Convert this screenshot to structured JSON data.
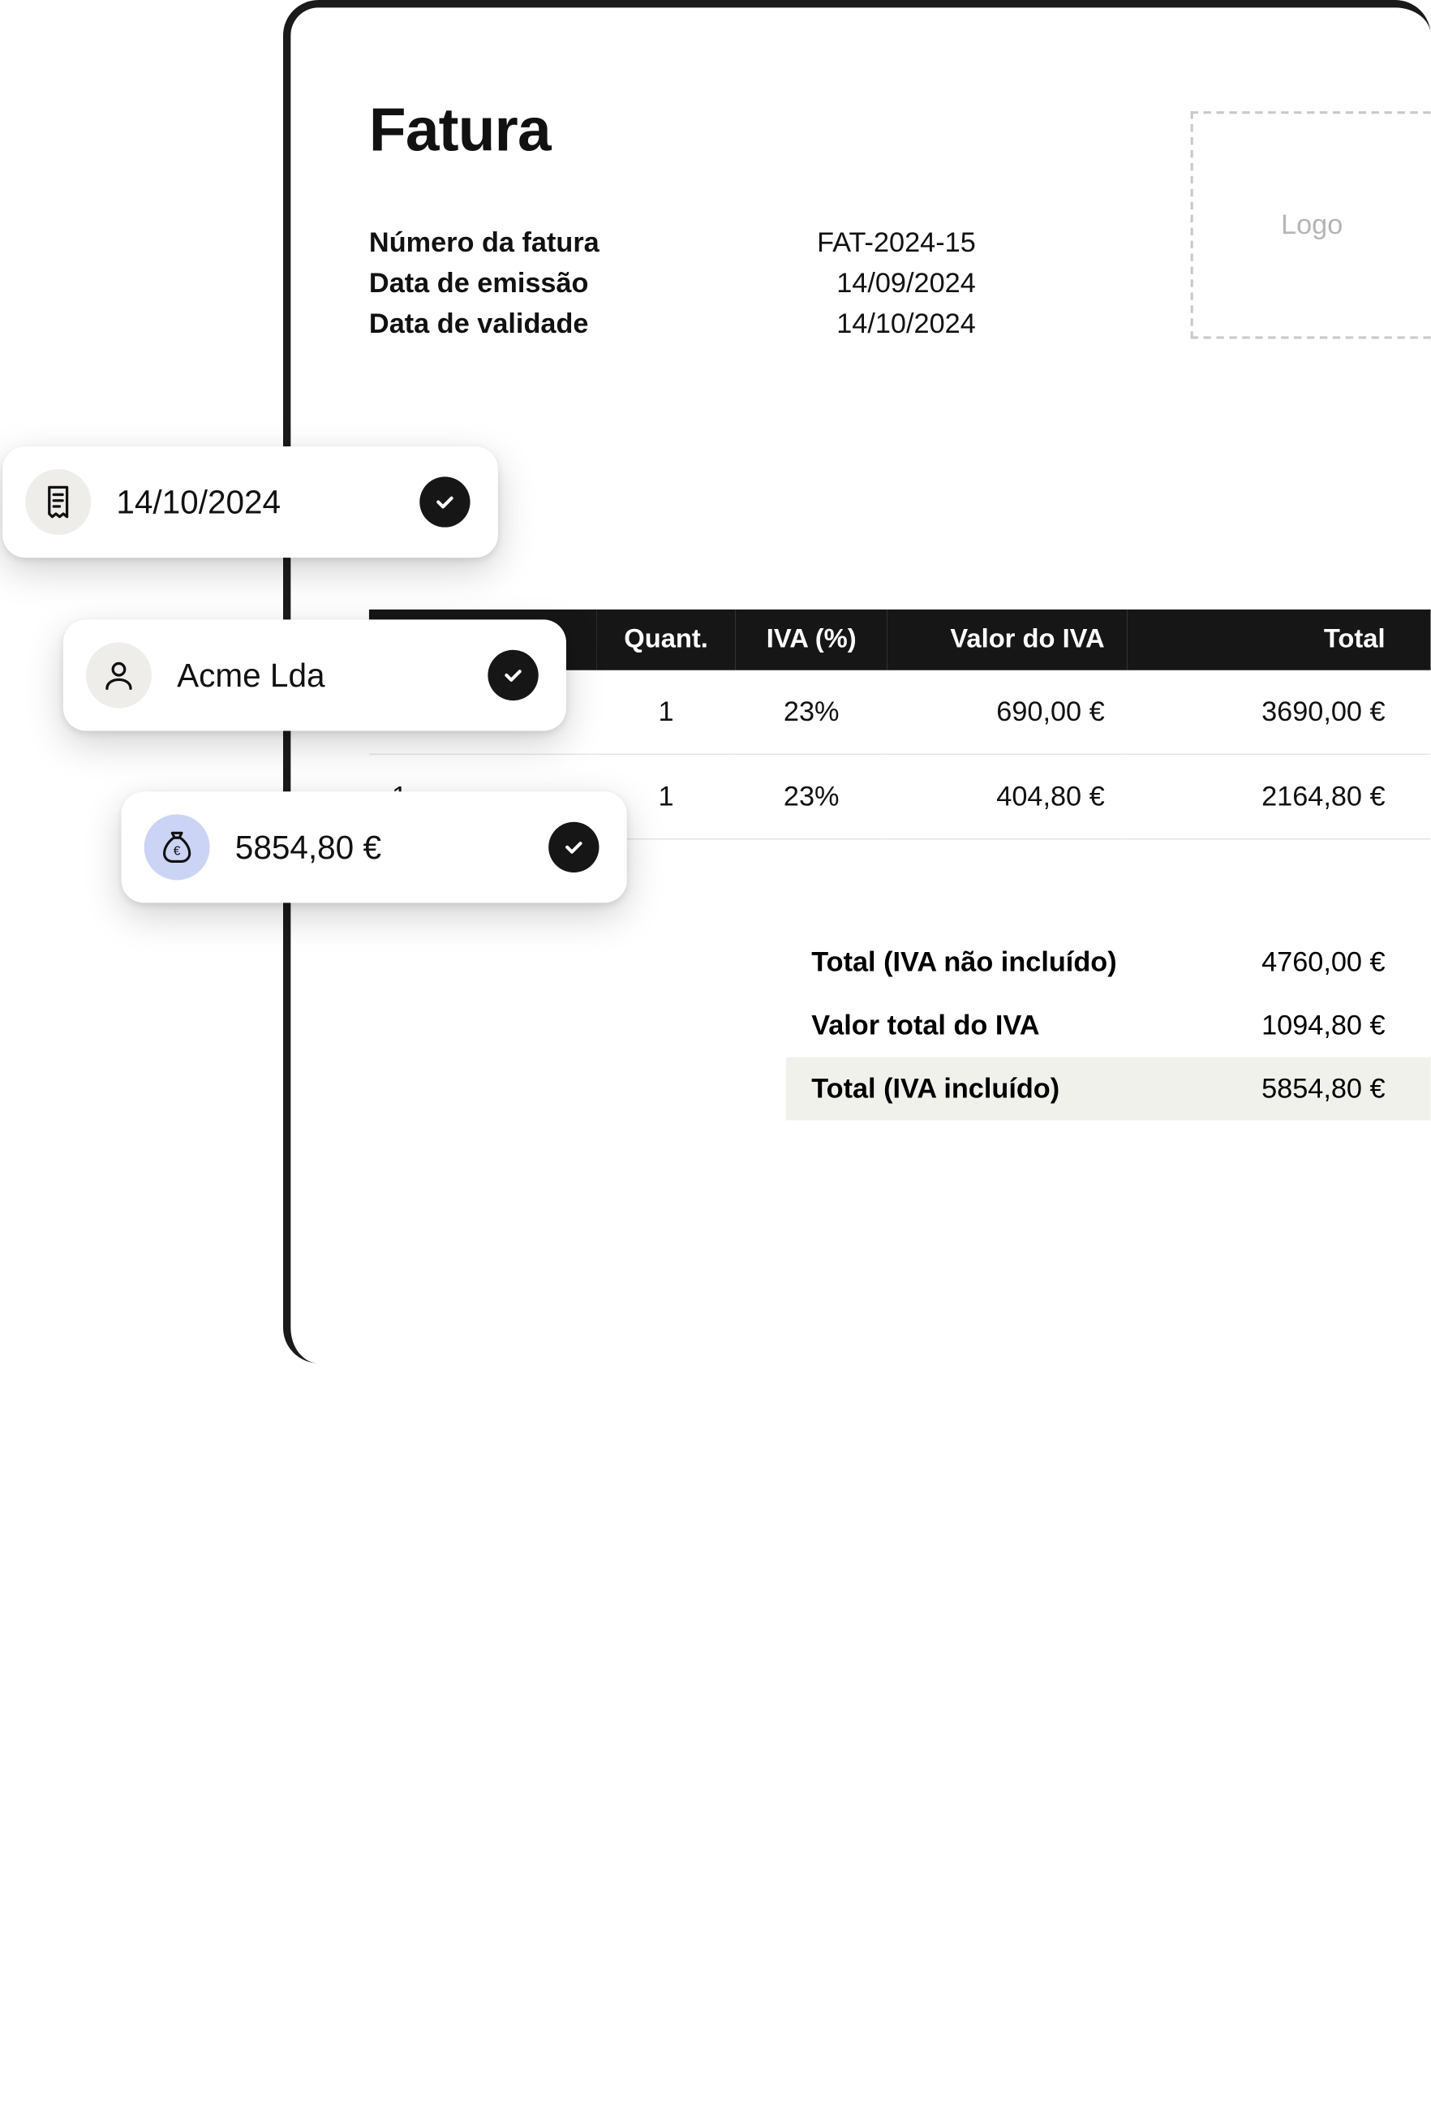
{
  "invoice": {
    "title": "Fatura",
    "logo_placeholder": "Logo",
    "meta": {
      "number_label": "Número da fatura",
      "number_value": "FAT-2024-15",
      "issue_label": "Data de emissão",
      "issue_value": "14/09/2024",
      "due_label": "Data de validade",
      "due_value": "14/10/2024"
    },
    "columns": {
      "desc": "",
      "qty": "Quant.",
      "iva": "IVA (%)",
      "iva_value": "Valor do IVA",
      "total": "Total"
    },
    "rows": [
      {
        "desc": "",
        "qty": "1",
        "iva": "23%",
        "iva_value": "690,00 €",
        "total": "3690,00 €"
      },
      {
        "desc": "1",
        "qty": "1",
        "iva": "23%",
        "iva_value": "404,80 €",
        "total": "2164,80 €"
      }
    ],
    "totals": {
      "subtotal_label": "Total (IVA não incluído)",
      "subtotal_value": "4760,00 €",
      "iva_total_label": "Valor total do IVA",
      "iva_total_value": "1094,80 €",
      "grand_label": "Total (IVA incluído)",
      "grand_value": "5854,80 €"
    }
  },
  "chips": {
    "date": "14/10/2024",
    "client": "Acme Lda",
    "amount": "5854,80 €"
  }
}
